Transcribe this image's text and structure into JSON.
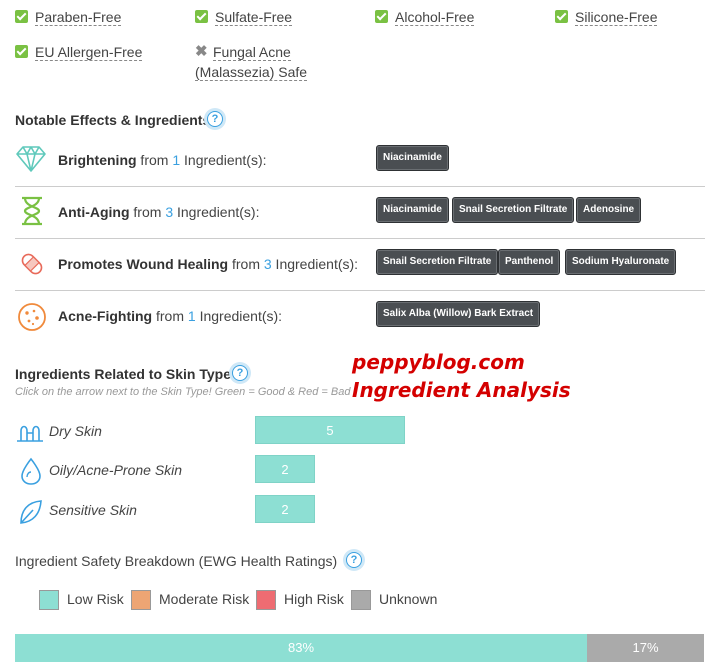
{
  "free_from": [
    {
      "label": "Paraben-Free",
      "status": "check"
    },
    {
      "label": "Sulfate-Free",
      "status": "check"
    },
    {
      "label": "Alcohol-Free",
      "status": "check"
    },
    {
      "label": "Silicone-Free",
      "status": "check"
    },
    {
      "label": "EU Allergen-Free",
      "status": "check"
    },
    {
      "label_line1": "Fungal Acne",
      "label_line2": "(Malassezia) Safe",
      "status": "cross"
    }
  ],
  "notable": {
    "title": "Notable Effects & Ingredients",
    "help": "?",
    "effects": [
      {
        "name": "Brightening",
        "pre": " from ",
        "count": "1",
        "post": " Ingredient(s):",
        "icon": "diamond-icon",
        "tags": [
          "Niacinamide"
        ]
      },
      {
        "name": "Anti-Aging",
        "pre": " from ",
        "count": "3",
        "post": " Ingredient(s):",
        "icon": "hourglass-icon",
        "tags": [
          "Niacinamide",
          "Snail Secretion Filtrate",
          "Adenosine"
        ]
      },
      {
        "name": "Promotes Wound Healing",
        "pre": " from ",
        "count": "3",
        "post": " Ingredient(s):",
        "icon": "bandage-icon",
        "tags": [
          "Snail Secretion Filtrate",
          "Panthenol",
          "Sodium Hyaluronate"
        ]
      },
      {
        "name": "Acne-Fighting",
        "pre": " from ",
        "count": "1",
        "post": " Ingredient(s):",
        "icon": "acne-icon",
        "tags": [
          "Salix Alba (Willow) Bark Extract"
        ]
      }
    ]
  },
  "skin_types": {
    "title": "Ingredients Related to Skin Types",
    "help": "?",
    "hint": "Click on the arrow next to the Skin Type! Green = Good & Red = Bad",
    "rows": [
      {
        "label": "Dry Skin",
        "value": "5",
        "icon": "dry-skin-icon"
      },
      {
        "label": "Oily/Acne-Prone Skin",
        "value": "2",
        "icon": "oily-skin-icon"
      },
      {
        "label": "Sensitive Skin",
        "value": "2",
        "icon": "sensitive-skin-icon"
      }
    ]
  },
  "safety": {
    "title": "Ingredient Safety Breakdown (EWG Health Ratings)",
    "help": "?",
    "legend": [
      {
        "label": "Low Risk",
        "color": "#8ddfd3"
      },
      {
        "label": "Moderate Risk",
        "color": "#eda574"
      },
      {
        "label": "High Risk",
        "color": "#ee6c72"
      },
      {
        "label": "Unknown",
        "color": "#aaaaaa"
      }
    ],
    "bar": [
      {
        "label": "83%",
        "fraction": 0.83,
        "color": "#8ddfd3"
      },
      {
        "label": "17%",
        "fraction": 0.17,
        "color": "#aaaaaa"
      }
    ]
  },
  "watermark": {
    "line1": "peppyblog.com",
    "line2": "Ingredient Analysis"
  }
}
